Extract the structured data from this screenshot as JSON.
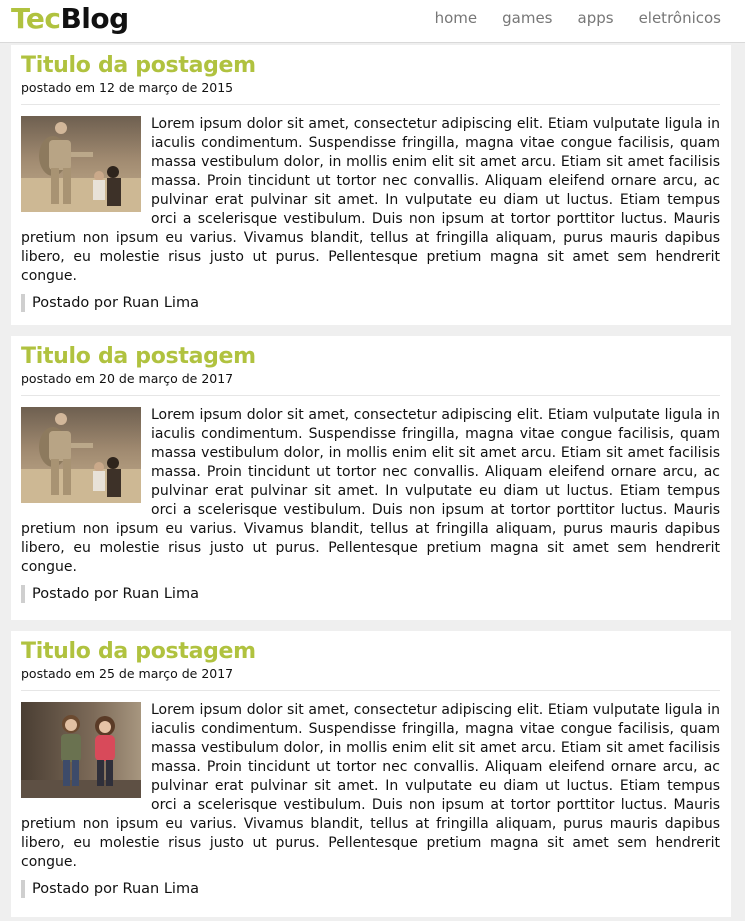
{
  "header": {
    "logo_part1": "Tec",
    "logo_part2": "Blog",
    "nav": [
      "home",
      "games",
      "apps",
      "eletrônicos"
    ]
  },
  "posts": [
    {
      "title": "Titulo da postagem",
      "date": "postado em 12 de março de 2015",
      "image": "soldier-and-child-photo",
      "body": "Lorem ipsum dolor sit amet, consectetur adipiscing elit. Etiam vulputate ligula in iaculis condimentum. Suspendisse fringilla, magna vitae congue facilisis, quam massa vestibulum dolor, in mollis enim elit sit amet arcu. Etiam sit amet facilisis massa. Proin tincidunt ut tortor nec convallis. Aliquam eleifend ornare arcu, ac pulvinar erat pulvinar sit amet. In vulputate eu diam ut luctus. Etiam tempus orci a scelerisque vestibulum. Duis non ipsum at tortor porttitor luctus. Mauris pretium non ipsum eu varius. Vivamus blandit, tellus at fringilla aliquam, purus mauris dapibus libero, eu molestie risus justo ut purus. Pellentesque pretium magna sit amet sem hendrerit congue.",
      "author": "Postado por Ruan Lima"
    },
    {
      "title": "Titulo da postagem",
      "date": "postado em 20 de março de 2017",
      "image": "soldier-and-child-photo",
      "body": "Lorem ipsum dolor sit amet, consectetur adipiscing elit. Etiam vulputate ligula in iaculis condimentum. Suspendisse fringilla, magna vitae congue facilisis, quam massa vestibulum dolor, in mollis enim elit sit amet arcu. Etiam sit amet facilisis massa. Proin tincidunt ut tortor nec convallis. Aliquam eleifend ornare arcu, ac pulvinar erat pulvinar sit amet. In vulputate eu diam ut luctus. Etiam tempus orci a scelerisque vestibulum. Duis non ipsum at tortor porttitor luctus. Mauris pretium non ipsum eu varius. Vivamus blandit, tellus at fringilla aliquam, purus mauris dapibus libero, eu molestie risus justo ut purus. Pellentesque pretium magna sit amet sem hendrerit congue.",
      "author": "Postado por Ruan Lima"
    },
    {
      "title": "Titulo da postagem",
      "date": "postado em 25 de março de 2017",
      "image": "two-children-photo",
      "body": "Lorem ipsum dolor sit amet, consectetur adipiscing elit. Etiam vulputate ligula in iaculis condimentum. Suspendisse fringilla, magna vitae congue facilisis, quam massa vestibulum dolor, in mollis enim elit sit amet arcu. Etiam sit amet facilisis massa. Proin tincidunt ut tortor nec convallis. Aliquam eleifend ornare arcu, ac pulvinar erat pulvinar sit amet. In vulputate eu diam ut luctus. Etiam tempus orci a scelerisque vestibulum. Duis non ipsum at tortor porttitor luctus. Mauris pretium non ipsum eu varius. Vivamus blandit, tellus at fringilla aliquam, purus mauris dapibus libero, eu molestie risus justo ut purus. Pellentesque pretium magna sit amet sem hendrerit congue.",
      "author": "Postado por Ruan Lima"
    }
  ],
  "colors": {
    "accent": "#b0c23f",
    "background": "#efefef",
    "card": "#ffffff",
    "nav_text": "#777777"
  }
}
